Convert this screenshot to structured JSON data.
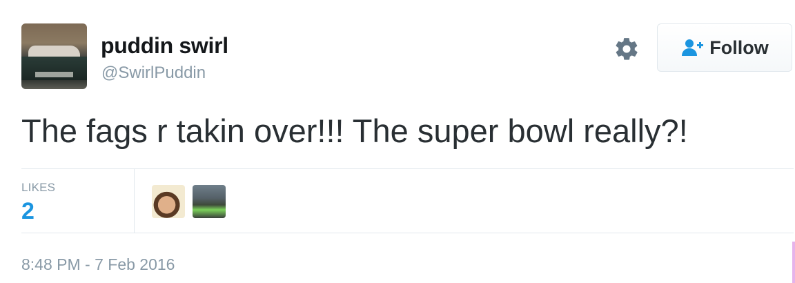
{
  "profile": {
    "display_name": "puddin swirl",
    "handle": "@SwirlPuddin",
    "avatar_icon": "user-avatar"
  },
  "actions": {
    "settings_icon": "gear-icon",
    "follow_label": "Follow",
    "follow_icon": "add-user-icon"
  },
  "tweet": {
    "text": "The fags r takin over!!! The super bowl really?!"
  },
  "stats": {
    "likes_label": "LIKES",
    "likes_count": "2"
  },
  "likers": [
    {
      "icon": "user-avatar"
    },
    {
      "icon": "user-avatar"
    }
  ],
  "meta": {
    "timestamp": "8:48 PM - 7 Feb 2016"
  },
  "colors": {
    "accent": "#1b95e0",
    "text": "#292f33",
    "muted": "#8899a6",
    "border": "#e1e8ed"
  }
}
